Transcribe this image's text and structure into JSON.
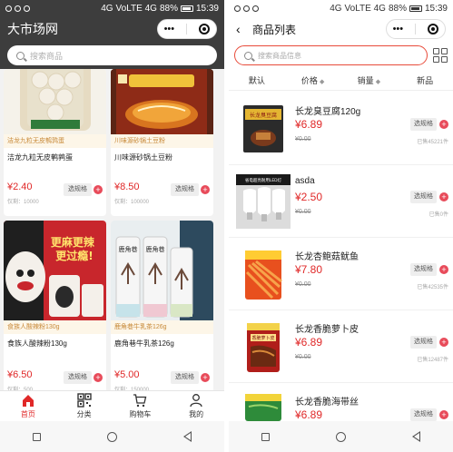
{
  "status_bar": {
    "left": {
      "network": "4G",
      "volte": "VoLTE 4G",
      "battery": "88%",
      "time": "15:39"
    },
    "right": {
      "network": "4G",
      "volte": "VoLTE 4G",
      "battery": "88%",
      "time": "15:39"
    }
  },
  "left_screen": {
    "app_title": "大市场网",
    "search_placeholder": "搜索商品",
    "products": [
      {
        "tag": "洁龙九粒无皮鹌鹑蛋",
        "name": "洁龙九粒无皮鹌鹑蛋",
        "price": "¥2.40",
        "stock": "仅剩：10000",
        "spec_label": "选规格"
      },
      {
        "tag": "川味源砂锅土豆粉",
        "name": "川味源砂锅土豆粉",
        "price": "¥8.50",
        "stock": "仅剩：100000",
        "spec_label": "选规格"
      },
      {
        "tag": "食族人酸辣粉130g",
        "name": "食族人酸辣粉130g",
        "price": "¥6.50",
        "stock": "仅剩：500",
        "spec_label": "选规格"
      },
      {
        "tag": "鹿角巷牛乳茶126g",
        "name": "鹿角巷牛乳茶126g",
        "price": "¥5.00",
        "stock": "仅剩：150000",
        "spec_label": "选规格"
      }
    ],
    "product_images": {
      "p3_text": "更麻更辣 更过瘾！",
      "p4_text": "鹿角巷"
    },
    "tabbar": [
      {
        "label": "首页",
        "icon": "home-icon"
      },
      {
        "label": "分类",
        "icon": "qr-grid-icon"
      },
      {
        "label": "购物车",
        "icon": "cart-icon"
      },
      {
        "label": "我的",
        "icon": "person-icon"
      }
    ]
  },
  "right_screen": {
    "page_title": "商品列表",
    "search_placeholder": "搜索商品信息",
    "sort_tabs": [
      {
        "label": "默认",
        "arrow": ""
      },
      {
        "label": "价格",
        "arrow": "◆"
      },
      {
        "label": "销量",
        "arrow": "◆"
      },
      {
        "label": "新品",
        "arrow": ""
      }
    ],
    "items": [
      {
        "name": "长龙臭豆腐120g",
        "price": "¥6.89",
        "original_price": "¥0.00",
        "spec_label": "选规格",
        "sold": "已售45221件",
        "image_text": "长龙臭豆腐"
      },
      {
        "name": "asda",
        "price": "¥2.50",
        "original_price": "¥0.00",
        "spec_label": "选规格",
        "sold": "已售0件",
        "image_text": "省电超亮耐用LED灯"
      },
      {
        "name": "长龙杏鲍菇鱿鱼",
        "price": "¥7.80",
        "original_price": "¥0.00",
        "spec_label": "选规格",
        "sold": "已售42535件",
        "image_text": ""
      },
      {
        "name": "长龙香脆萝卜皮",
        "price": "¥6.89",
        "original_price": "¥0.00",
        "spec_label": "选规格",
        "sold": "已售12487件",
        "image_text": "香脆萝卜皮"
      },
      {
        "name": "长龙香脆海带丝",
        "price": "¥6.89",
        "original_price": "¥0.00",
        "spec_label": "选规格",
        "sold": "",
        "image_text": ""
      }
    ]
  },
  "colors": {
    "accent_red": "#e02828",
    "header_dark": "#3d3d3d",
    "plus_button": "#e84b5a"
  }
}
